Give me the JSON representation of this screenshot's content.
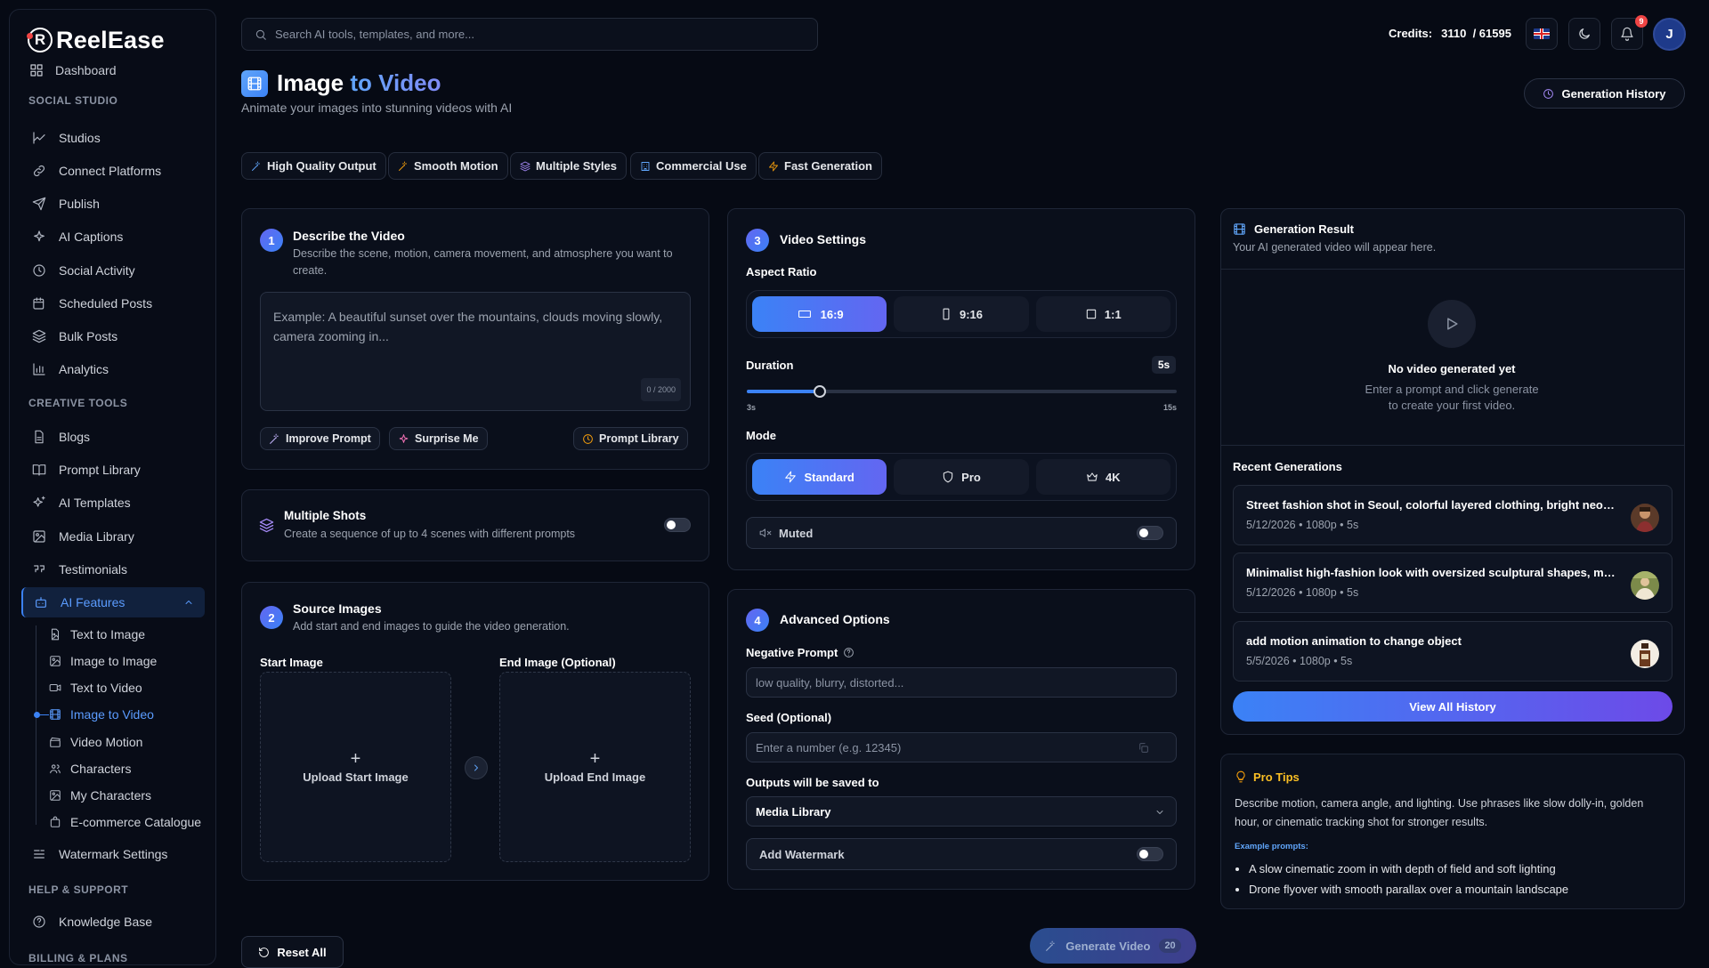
{
  "app": {
    "name": "ReelEase",
    "logo_letter": "R"
  },
  "sidebar": {
    "partial_item": "Dashboard",
    "sections": {
      "social": "SOCIAL STUDIO",
      "creative": "CREATIVE TOOLS",
      "help": "HELP & SUPPORT",
      "billing": "BILLING & PLANS"
    },
    "social_items": [
      "Studios",
      "Connect Platforms",
      "Publish",
      "AI Captions",
      "Social Activity",
      "Scheduled Posts",
      "Bulk Posts",
      "Analytics"
    ],
    "creative_items": [
      "Blogs",
      "Prompt Library",
      "AI Templates",
      "Media Library",
      "Testimonials"
    ],
    "ai_features": "AI Features",
    "ai_sub_items": [
      "Text to Image",
      "Image to Image",
      "Text to Video",
      "Image to Video",
      "Video Motion",
      "Characters",
      "My Characters",
      "E-commerce Catalogue"
    ],
    "watermark": "Watermark Settings",
    "help_items": [
      "Knowledge Base"
    ]
  },
  "topbar": {
    "search_placeholder": "Search AI tools, templates, and more...",
    "credits_label": "Credits:",
    "credits_value": "3110",
    "credits_total": "/ 61595",
    "notification_count": "9",
    "avatar_letter": "J"
  },
  "page": {
    "title_main": "Image",
    "title_accent": "to Video",
    "subtitle": "Animate your images into stunning videos with AI",
    "history_button": "Generation History",
    "chips": [
      "High Quality Output",
      "Smooth Motion",
      "Multiple Styles",
      "Commercial Use",
      "Fast Generation"
    ]
  },
  "describe": {
    "step": "1",
    "title": "Describe the Video",
    "desc": "Describe the scene, motion, camera movement, and atmosphere you want to create.",
    "placeholder": "Example: A beautiful sunset over the mountains, clouds moving slowly, camera zooming in...",
    "counter": "0 / 2000",
    "improve": "Improve Prompt",
    "surprise": "Surprise Me",
    "library": "Prompt Library"
  },
  "shots": {
    "title": "Multiple Shots",
    "desc": "Create a sequence of up to 4 scenes with different prompts",
    "enabled": false
  },
  "source": {
    "step": "2",
    "title": "Source Images",
    "desc": "Add start and end images to guide the video generation.",
    "start_label": "Start Image",
    "end_label": "End Image (Optional)",
    "upload_start": "Upload Start Image",
    "upload_end": "Upload End Image"
  },
  "settings": {
    "step": "3",
    "title": "Video Settings",
    "aspect_label": "Aspect Ratio",
    "aspect_options": [
      "16:9",
      "9:16",
      "1:1"
    ],
    "aspect_selected": "16:9",
    "duration_label": "Duration",
    "duration_value": "5s",
    "duration_min": "3s",
    "duration_max": "15s",
    "duration_fraction": 0.17,
    "mode_label": "Mode",
    "mode_options": [
      "Standard",
      "Pro",
      "4K"
    ],
    "mode_selected": "Standard",
    "muted_label": "Muted",
    "muted_enabled": false
  },
  "advanced": {
    "step": "4",
    "title": "Advanced Options",
    "negative_label": "Negative Prompt",
    "negative_placeholder": "low quality, blurry, distorted...",
    "seed_label": "Seed (Optional)",
    "seed_placeholder": "Enter a number (e.g. 12345)",
    "outputs_label": "Outputs will be saved to",
    "outputs_value": "Media Library",
    "watermark_label": "Add Watermark",
    "watermark_enabled": false
  },
  "actions": {
    "reset": "Reset All",
    "generate": "Generate Video",
    "generate_cost": "20"
  },
  "result": {
    "title": "Generation Result",
    "desc": "Your AI generated video will appear here.",
    "empty_title": "No video generated yet",
    "empty_desc": "Enter a prompt and click generate to create your first video.",
    "recent_label": "Recent Generations",
    "recent": [
      {
        "title": "Street fashion shot in Seoul, colorful layered clothing, bright neon lights",
        "meta": "5/12/2026 • 1080p • 5s"
      },
      {
        "title": "Minimalist high-fashion look with oversized sculptural shapes, monochrome",
        "meta": "5/12/2026 • 1080p • 5s"
      },
      {
        "title": "add motion animation to change object",
        "meta": "5/5/2026 • 1080p • 5s"
      }
    ],
    "view_all": "View All History"
  },
  "tips": {
    "title": "Pro Tips",
    "body": "Describe motion, camera angle, and lighting. Use phrases like slow dolly-in, golden hour, or cinematic tracking shot for stronger results.",
    "examples_label": "Example prompts:",
    "examples": [
      "A slow cinematic zoom in with depth of field and soft lighting",
      "Drone flyover with smooth parallax over a mountain landscape"
    ]
  },
  "colors": {
    "accent": "#3b82f6",
    "accent2": "#6366f1",
    "background": "#060a14",
    "card": "#0a0f1b",
    "danger": "#ef4444"
  }
}
